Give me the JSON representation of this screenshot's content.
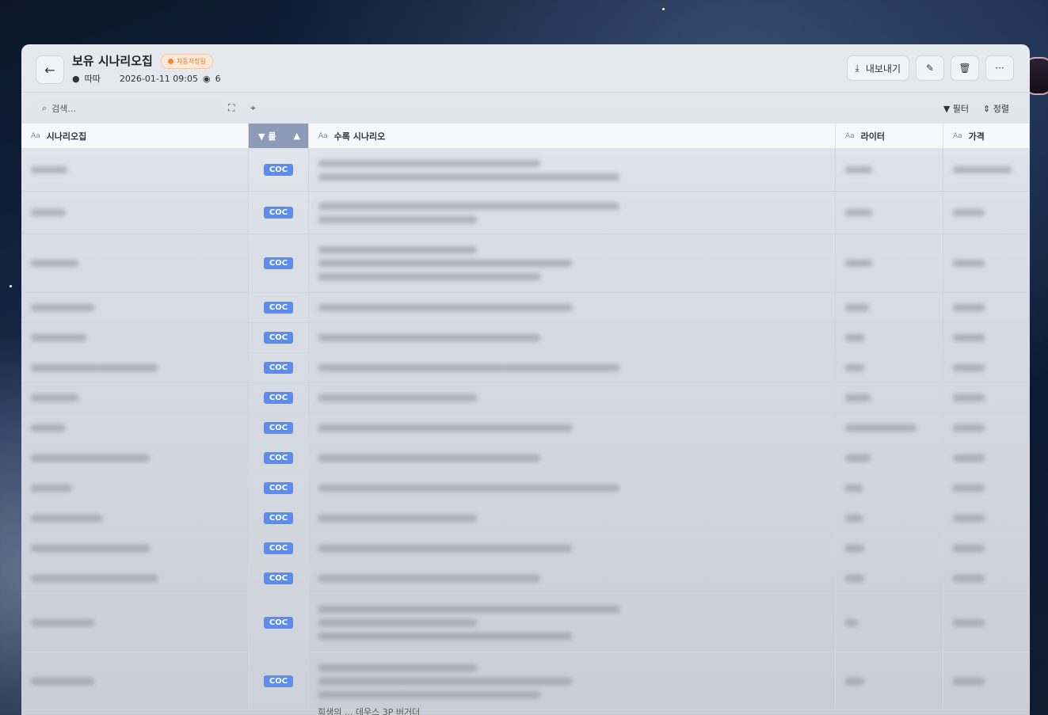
{
  "header": {
    "title": "보유 시나리오집",
    "badge": "자동저장됨",
    "author": "따따",
    "timestamp": "2026-01-11 09:05",
    "views": "6",
    "export_label": "내보내기"
  },
  "toolbar": {
    "search_placeholder": "검색...",
    "filter_label": "필터",
    "sort_label": "정렬"
  },
  "table": {
    "columns": [
      "시나리오집",
      "룰",
      "수록 시나리오",
      "라이터",
      "가격"
    ],
    "aa_label": "Aa",
    "rule_value": "COC",
    "rows": [
      {
        "lines": 2
      },
      {
        "lines": 2
      },
      {
        "lines": 3
      },
      {
        "lines": 1
      },
      {
        "lines": 1
      },
      {
        "lines": 1
      },
      {
        "lines": 1
      },
      {
        "lines": 1
      },
      {
        "lines": 1
      },
      {
        "lines": 1
      },
      {
        "lines": 1
      },
      {
        "lines": 1
      },
      {
        "lines": 1
      },
      {
        "lines": 3
      },
      {
        "lines": 4
      }
    ],
    "partial_text": "희생의 ... 데우스 3P 버거더"
  },
  "colors": {
    "accent": "#5b8def",
    "badge_bg": "#fde9d9",
    "badge_text": "#e07a2e",
    "sorted_header": "#8d9bb9"
  }
}
